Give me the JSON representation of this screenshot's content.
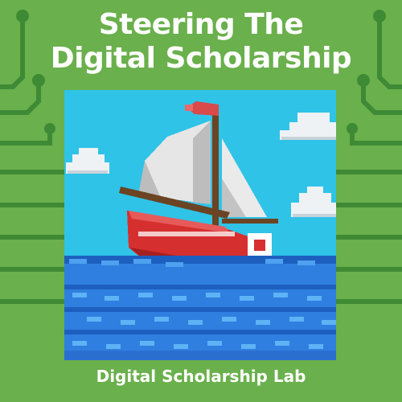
{
  "title": {
    "line_1": "Steering The",
    "line_2": "Digital Scholarship"
  },
  "footer": {
    "text": "Digital Scholarship Lab"
  },
  "artwork": {
    "subject": "pixel-art sailboat on ocean waves with clouds",
    "icon": "sailboat-icon"
  },
  "colors": {
    "background": "#6ab04c",
    "circuit": "#3f8a35",
    "sky": "#2fc3e7",
    "sea": "#2f7fe0",
    "hull": "#d62f2f",
    "sail": "#e6e6e6",
    "flag": "#d94a4a",
    "text": "#ffffff"
  }
}
